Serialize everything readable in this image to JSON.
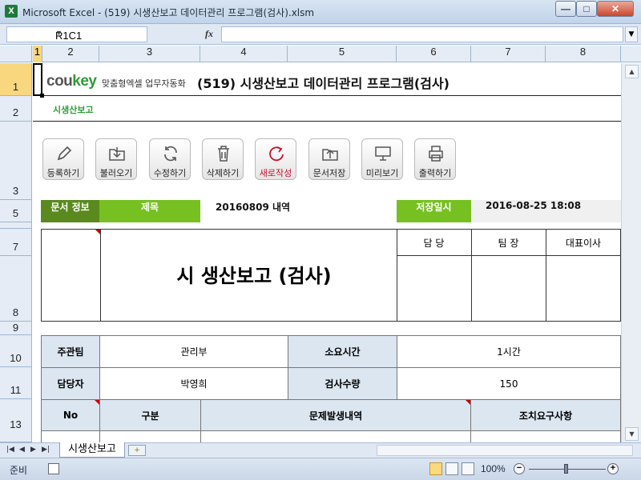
{
  "window": {
    "title": "Microsoft Excel - (519) 시생산보고 데이터관리 프로그램(검사).xlsm",
    "controls": {
      "minimize": "—",
      "maximize": "□",
      "close": "✕"
    }
  },
  "formula_bar": {
    "name_box": "R1C1",
    "fx": "fx",
    "content": ""
  },
  "columns": [
    "1",
    "2",
    "3",
    "4",
    "5",
    "6",
    "7",
    "8"
  ],
  "rows": [
    "1",
    "2",
    "3",
    "5",
    "7",
    "8",
    "9",
    "10",
    "11",
    "13"
  ],
  "header": {
    "logo_main": "cou",
    "logo_accent": "key",
    "logo_sub": "맞춤형엑셀 업무자동화",
    "title": "(519) 시생산보고 데이터관리 프로그램(검사)",
    "subtitle": "시생산보고"
  },
  "toolbar": [
    {
      "label": "등록하기",
      "icon": "pencil-icon"
    },
    {
      "label": "불러오기",
      "icon": "folder-download-icon"
    },
    {
      "label": "수정하기",
      "icon": "refresh-icon"
    },
    {
      "label": "삭제하기",
      "icon": "trash-icon"
    },
    {
      "label": "새로작성",
      "icon": "new-circle-icon"
    },
    {
      "label": "문서저장",
      "icon": "folder-upload-icon"
    },
    {
      "label": "미리보기",
      "icon": "monitor-icon"
    },
    {
      "label": "출력하기",
      "icon": "printer-icon"
    }
  ],
  "doc_info": {
    "section_label": "문서 정보",
    "title_label": "제목",
    "title_value": "20160809 내역",
    "saved_label": "저장일시",
    "saved_value": "2016-08-25 18:08"
  },
  "approval": {
    "doc_title": "시 생산보고 (검사)",
    "signers": [
      "담 당",
      "팀 장",
      "대표이사"
    ]
  },
  "details": {
    "dept_label": "주관팀",
    "dept_value": "관리부",
    "time_label": "소요시간",
    "time_value": "1시간",
    "owner_label": "담당자",
    "owner_value": "박영희",
    "qty_label": "검사수량",
    "qty_value": "150"
  },
  "table": {
    "headers": [
      "No",
      "구분",
      "문제발생내역",
      "조치요구사항"
    ]
  },
  "sheet_tabs": {
    "active": "시생산보고"
  },
  "status": {
    "ready": "준비",
    "zoom": "100%"
  },
  "colors": {
    "accent_green": "#77c022",
    "dark_green": "#5a8a1e",
    "header_blue": "#dce6f1",
    "selected": "#f8d77f"
  }
}
